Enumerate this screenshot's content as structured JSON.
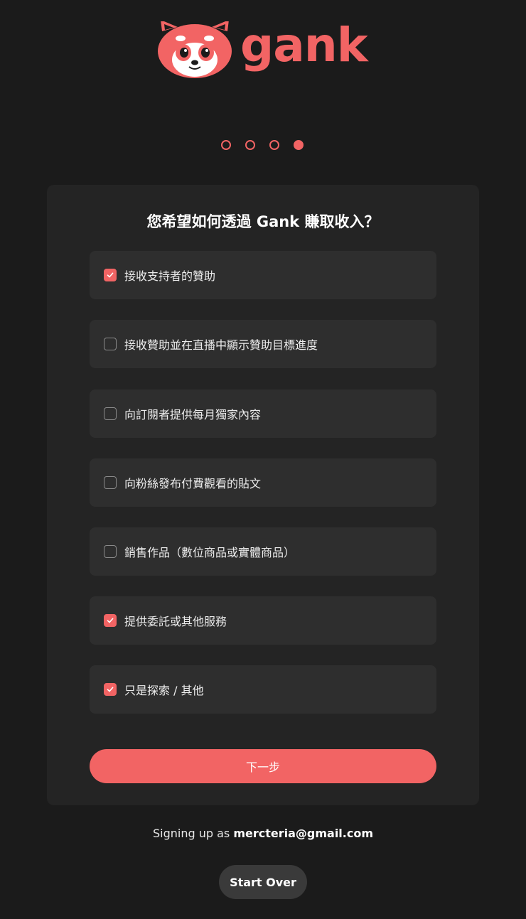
{
  "brand": {
    "name": "gank",
    "color": "#f26464"
  },
  "stepper": {
    "total_steps": 4,
    "current_step": 4
  },
  "card": {
    "title": "您希望如何透過 Gank 賺取收入？",
    "options": [
      {
        "label": "接收支持者的贊助",
        "checked": true
      },
      {
        "label": "接收贊助並在直播中顯示贊助目標進度",
        "checked": false
      },
      {
        "label": "向訂閱者提供每月獨家內容",
        "checked": false
      },
      {
        "label": "向粉絲發布付費觀看的貼文",
        "checked": false
      },
      {
        "label": "銷售作品（數位商品或實體商品）",
        "checked": false
      },
      {
        "label": "提供委託或其他服務",
        "checked": true
      },
      {
        "label": "只是探索 / 其他",
        "checked": true
      }
    ],
    "next_label": "下一步"
  },
  "footer": {
    "signing_prefix": "Signing up as",
    "email": "mercteria@gmail.com",
    "start_over_label": "Start Over"
  }
}
